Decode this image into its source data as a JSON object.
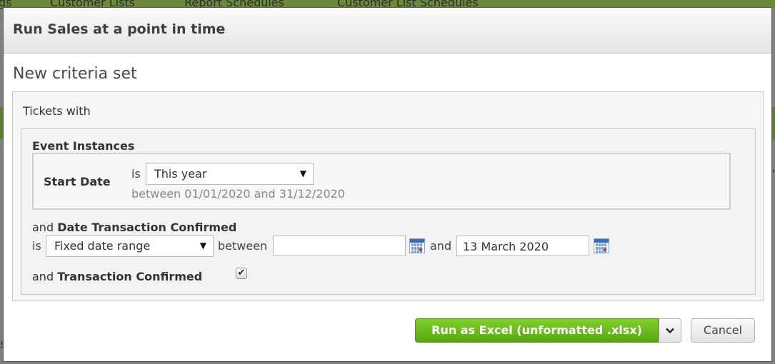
{
  "background": {
    "tabs": [
      "gs",
      "Customer Lists",
      "Report Schedules",
      "Customer List Schedules"
    ],
    "right_glyph": "'",
    "left_glyph": "s"
  },
  "dialog": {
    "title": "Run Sales at a point in time",
    "criteria_title": "New criteria set",
    "tickets_with": "Tickets with",
    "event_instances": {
      "heading": "Event Instances",
      "start_date_label": "Start Date",
      "is_label": "is",
      "selected": "This year",
      "hint": "between 01/01/2020 and 31/12/2020"
    },
    "date_transaction_confirmed": {
      "prefix": "and",
      "label": "Date Transaction Confirmed",
      "is_label": "is",
      "selected": "Fixed date range",
      "between_label": "between",
      "from_value": "",
      "and_label": "and",
      "to_value": "13 March 2020"
    },
    "transaction_confirmed": {
      "prefix": "and",
      "label": "Transaction Confirmed",
      "checked": true,
      "check_glyph": "✔"
    },
    "footer": {
      "run_label": "Run as Excel (unformatted .xlsx)",
      "cancel_label": "Cancel"
    }
  },
  "colors": {
    "run_button": "#6cbd1f",
    "header_green": "#6b8a3c"
  }
}
